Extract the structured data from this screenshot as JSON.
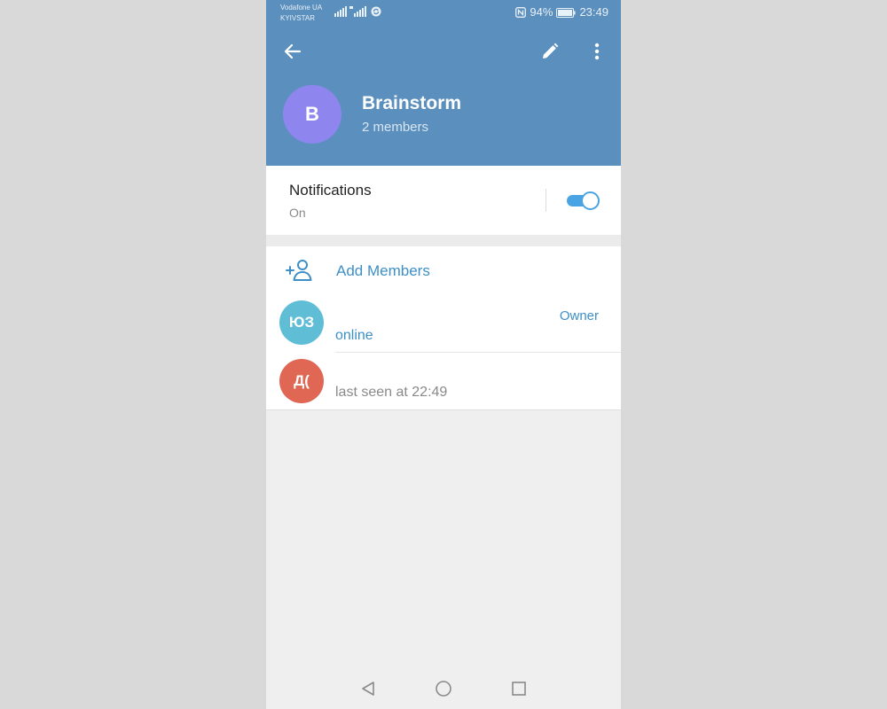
{
  "status_bar": {
    "carrier_1": "Vodafone UA",
    "carrier_2": "KYIVSTAR",
    "signal_1_label": "4G",
    "signal_2_label": "4G",
    "nfc_icon": "nfc-icon",
    "battery": "94%",
    "time": "23:49"
  },
  "toolbar": {
    "back_icon": "arrow-left-icon",
    "edit_icon": "pencil-icon",
    "more_icon": "more-vertical-icon"
  },
  "group": {
    "avatar_letter": "B",
    "avatar_color": "#8e85ee",
    "title": "Brainstorm",
    "subtitle": "2 members"
  },
  "notifications": {
    "title": "Notifications",
    "state": "On",
    "enabled": true
  },
  "members": {
    "add_label": "Add Members",
    "add_icon": "add-user-icon",
    "list": [
      {
        "initials": "ЮЗ",
        "avatar_color": "#5fbed6",
        "name": "",
        "status": "online",
        "status_color": "#3d8fc6",
        "role": "Owner"
      },
      {
        "initials": "Д(",
        "avatar_color": "#e06753",
        "name": "",
        "status": "last seen at 22:49",
        "status_color": "#8a8a8a",
        "role": ""
      }
    ]
  },
  "navbar": {
    "back_icon": "triangle-back-icon",
    "home_icon": "circle-home-icon",
    "recents_icon": "square-recents-icon"
  },
  "colors": {
    "header": "#5b8fbd",
    "accent": "#3d8fc6",
    "toggle": "#4aa3e2"
  }
}
